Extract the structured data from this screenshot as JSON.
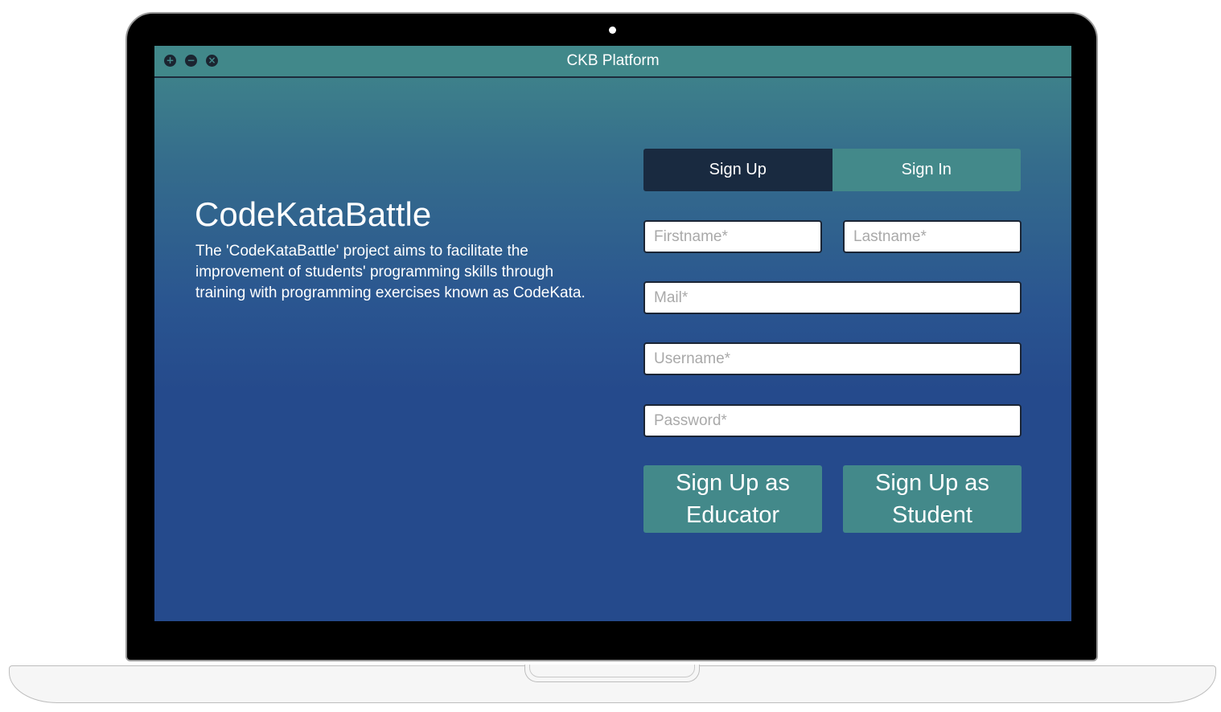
{
  "window": {
    "title": "CKB Platform",
    "controls": [
      {
        "icon": "plus-icon",
        "glyph": "+"
      },
      {
        "icon": "minus-icon",
        "glyph": "−"
      },
      {
        "icon": "close-icon",
        "glyph": "×"
      }
    ]
  },
  "intro": {
    "title": "CodeKataBattle",
    "description": "The 'CodeKataBattle' project aims to facilitate the improvement of students' programming skills through training with programming exercises known as CodeKata."
  },
  "tabs": {
    "sign_up": "Sign Up",
    "sign_in": "Sign In",
    "active": "sign_up"
  },
  "form": {
    "firstname": {
      "value": "",
      "placeholder": "Firstname*"
    },
    "lastname": {
      "value": "",
      "placeholder": "Lastname*"
    },
    "mail": {
      "value": "",
      "placeholder": "Mail*"
    },
    "username": {
      "value": "",
      "placeholder": "Username*"
    },
    "password": {
      "value": "",
      "placeholder": "Password*"
    }
  },
  "buttons": {
    "educator": "Sign Up as\nEducator",
    "student": "Sign Up as\nStudent"
  },
  "colors": {
    "title_bar": "#41888a",
    "active_tab": "#192a40",
    "accent": "#43898a",
    "background_bottom": "#254a8c"
  }
}
